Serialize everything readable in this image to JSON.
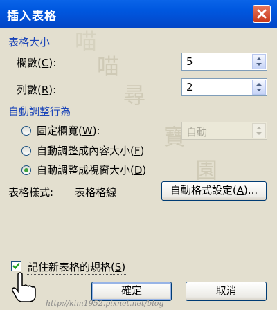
{
  "window": {
    "title": "插入表格"
  },
  "watermark_chars": [
    "喵",
    "喵",
    "尋",
    "寶",
    "園"
  ],
  "section_size": "表格大小",
  "columns": {
    "label_pre": "欄數(",
    "accel": "C",
    "label_post": "):",
    "value": "5"
  },
  "rows": {
    "label_pre": "列數(",
    "accel": "R",
    "label_post": "):",
    "value": "2"
  },
  "section_autofit": "自動調整行為",
  "fixed_width": {
    "label_pre": "固定欄寬(",
    "accel": "W",
    "label_post": "):",
    "value": "自動",
    "selected": false
  },
  "autofit_contents": {
    "label_pre": "自動調整成內容大小(",
    "accel": "F",
    "label_post": ")",
    "selected": false
  },
  "autofit_window": {
    "label_pre": "自動調整成視窗大小(",
    "accel": "D",
    "label_post": ")",
    "selected": true
  },
  "table_style": {
    "label": "表格樣式:",
    "value": "表格格線"
  },
  "autoformat_button": {
    "label_pre": "自動格式設定(",
    "accel": "A",
    "label_post": ")..."
  },
  "remember": {
    "label_pre": "記住新表格的規格(",
    "accel": "S",
    "label_post": ")",
    "checked": true
  },
  "ok_button": {
    "label": "確定"
  },
  "cancel_button": {
    "label": "取消"
  },
  "footer_url": "http://kim1952.pixnet.net/blog",
  "colors": {
    "title_bar": "#0054e3",
    "section_text": "#1d46b8",
    "dialog_bg": "#ece9d8"
  }
}
